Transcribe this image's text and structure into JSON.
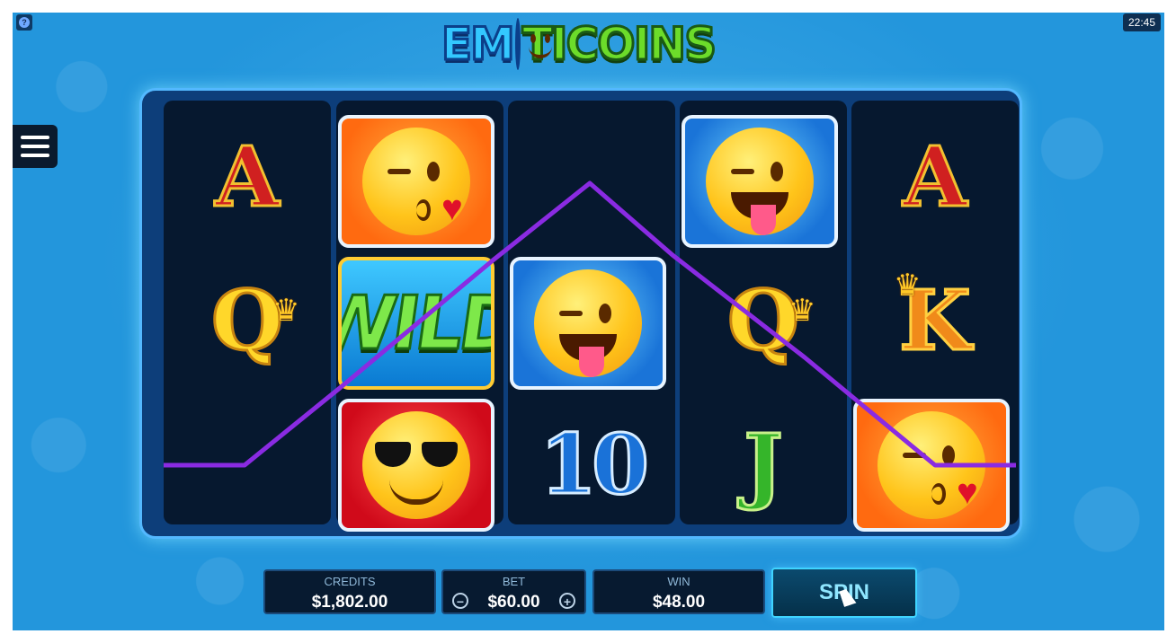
{
  "window": {
    "clock": "22:45",
    "help_icon": "question-icon",
    "menu_icon": "hamburger-icon"
  },
  "game": {
    "title": "EMOTICOINS",
    "title_part1": "EM",
    "title_part2": "TICOINS"
  },
  "reels": [
    [
      "A",
      "Q",
      ""
    ],
    [
      "kiss-emoji",
      "WILD",
      "sunglasses-emoji"
    ],
    [
      "",
      "tongue-wink-emoji",
      "10"
    ],
    [
      "tongue-wink-emoji",
      "Q",
      "J"
    ],
    [
      "A",
      "K",
      "kiss-emoji"
    ]
  ],
  "symbols": {
    "ace": "A",
    "queen": "Q",
    "king": "K",
    "jack": "J",
    "ten": "10",
    "wild": "WILD"
  },
  "payline": {
    "color": "#8a2be2"
  },
  "panel": {
    "credits_label": "CREDITS",
    "credits_value": "$1,802.00",
    "bet_label": "BET",
    "bet_value": "$60.00",
    "bet_minus": "−",
    "bet_plus": "+",
    "win_label": "WIN",
    "win_value": "$48.00",
    "spin_label": "SPIN"
  },
  "colors": {
    "background": "#2396dc",
    "reel_bg": "#06182f",
    "accent": "#3fd4ff"
  }
}
